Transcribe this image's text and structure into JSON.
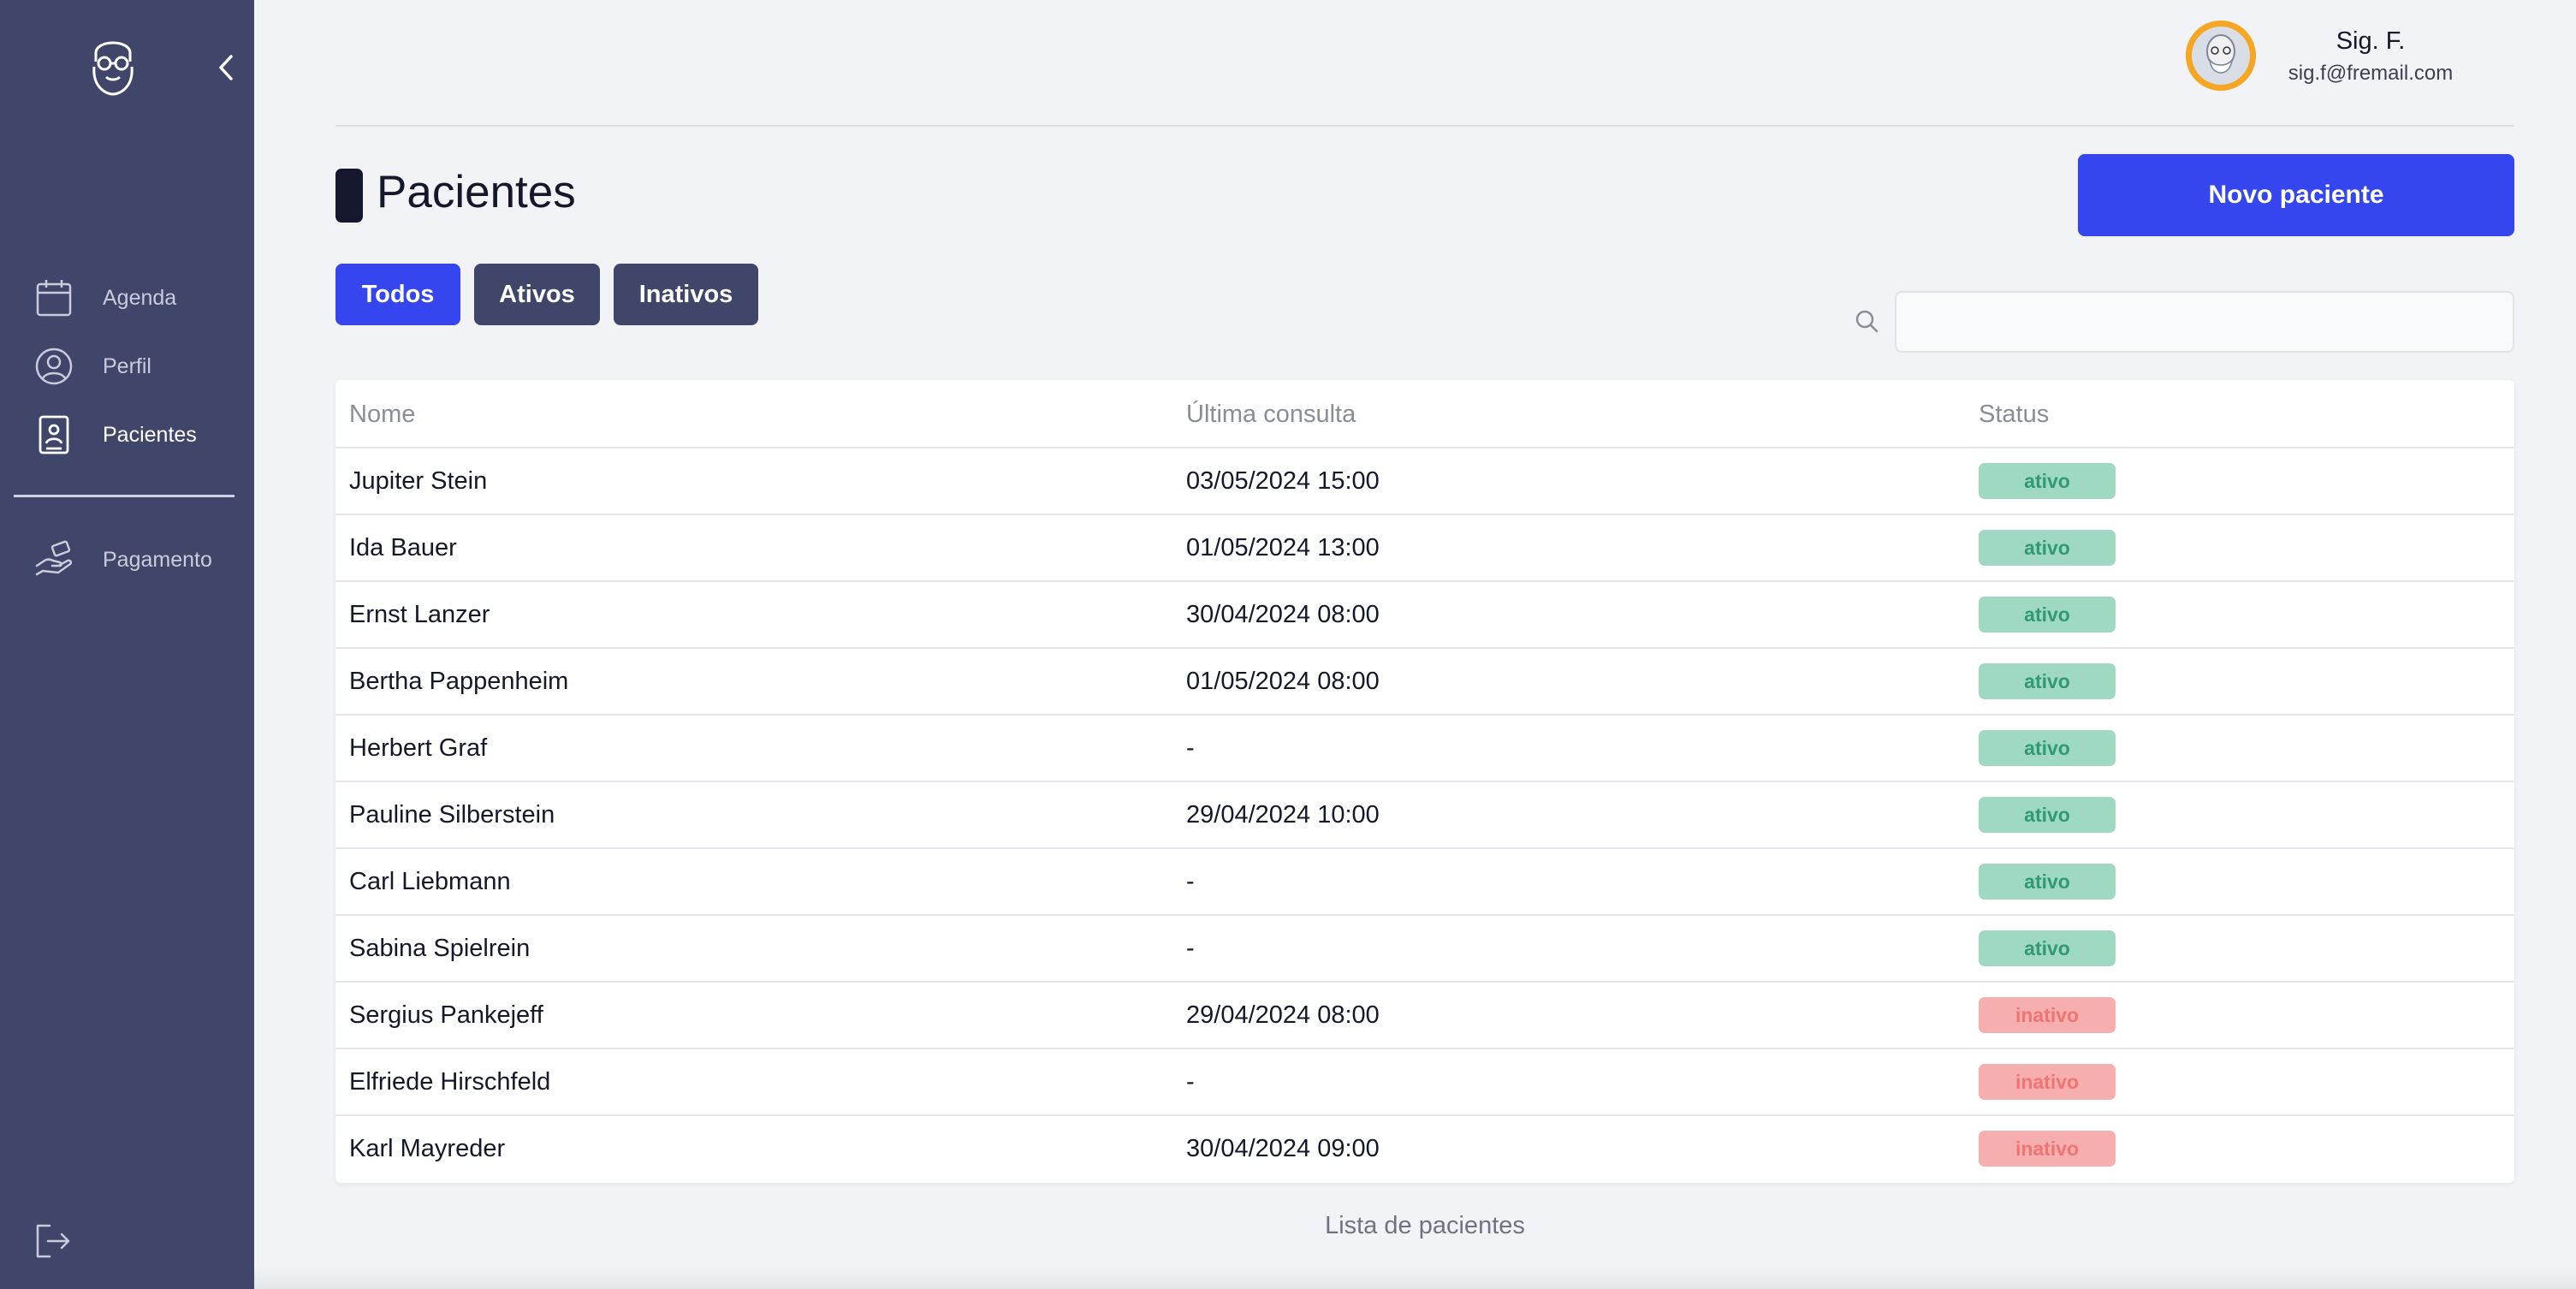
{
  "sidebar": {
    "items": [
      {
        "label": "Agenda",
        "icon": "calendar-icon"
      },
      {
        "label": "Perfil",
        "icon": "user-circle-icon"
      },
      {
        "label": "Pacientes",
        "icon": "patient-card-icon"
      },
      {
        "label": "Pagamento",
        "icon": "hand-payment-icon"
      }
    ],
    "active": "Pacientes"
  },
  "user": {
    "name": "Sig. F.",
    "email": "sig.f@fremail.com"
  },
  "page": {
    "title": "Pacientes",
    "new_button": "Novo paciente",
    "caption": "Lista de pacientes"
  },
  "filters": [
    {
      "label": "Todos",
      "active": true
    },
    {
      "label": "Ativos",
      "active": false
    },
    {
      "label": "Inativos",
      "active": false
    }
  ],
  "search": {
    "placeholder": "",
    "value": ""
  },
  "table": {
    "columns": [
      "Nome",
      "Última consulta",
      "Status"
    ],
    "rows": [
      {
        "name": "Jupiter Stein",
        "last": "03/05/2024 15:00",
        "status": "ativo"
      },
      {
        "name": "Ida Bauer",
        "last": "01/05/2024 13:00",
        "status": "ativo"
      },
      {
        "name": "Ernst Lanzer",
        "last": "30/04/2024 08:00",
        "status": "ativo"
      },
      {
        "name": "Bertha Pappenheim",
        "last": "01/05/2024 08:00",
        "status": "ativo"
      },
      {
        "name": "Herbert Graf",
        "last": "-",
        "status": "ativo"
      },
      {
        "name": "Pauline Silberstein",
        "last": "29/04/2024 10:00",
        "status": "ativo"
      },
      {
        "name": "Carl Liebmann",
        "last": "-",
        "status": "ativo"
      },
      {
        "name": "Sabina Spielrein",
        "last": "-",
        "status": "ativo"
      },
      {
        "name": "Sergius Pankejeff",
        "last": "29/04/2024 08:00",
        "status": "inativo"
      },
      {
        "name": "Elfriede Hirschfeld",
        "last": "-",
        "status": "inativo"
      },
      {
        "name": "Karl Mayreder",
        "last": "30/04/2024 09:00",
        "status": "inativo"
      }
    ]
  },
  "colors": {
    "sidebar": "#3f4669",
    "primary": "#3546ef",
    "active_badge_bg": "#9fd8c3",
    "active_badge_text": "#2f9a74",
    "inactive_badge_bg": "#f6aeae",
    "inactive_badge_text": "#ef7575"
  }
}
